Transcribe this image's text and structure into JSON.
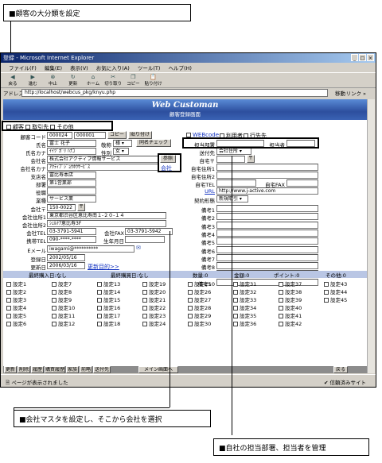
{
  "callouts": {
    "top": "■顧客の大分類を設定",
    "bottom_left": "■会社マスタを設定し、そこから会社を選択",
    "bottom_right": "■自社の担当部署、担当者を管理"
  },
  "window": {
    "title": "登録 - Microsoft Internet Explorer",
    "menu": [
      "ファイル(F)",
      "編集(E)",
      "表示(V)",
      "お気に入り(A)",
      "ツール(T)",
      "ヘルプ(H)"
    ],
    "toolbar": [
      "戻る",
      "進む",
      "中止",
      "更新",
      "ホーム",
      "切り取り",
      "コピー",
      "貼り付け"
    ],
    "address_label": "アドレス(D)",
    "address": "http://localhost/webcus_pkg/knyu.php",
    "go": "移動",
    "links": "リンク »"
  },
  "banner": {
    "title": "Web Customan",
    "subtitle": "顧客登録画面"
  },
  "categories": [
    "顧客",
    "取引先",
    "その他"
  ],
  "form": {
    "customer_code_label": "顧客コード",
    "customer_code": "000024",
    "customer_code2": "000001",
    "copy_btn": "コピー",
    "paste_btn": "貼り付け",
    "name_label": "氏名",
    "name_value": "富士 花子",
    "honorific_label": "敬称",
    "honorific_value": "様",
    "same_name_check": "同名チェック",
    "kana_label": "氏名カナ",
    "kana_value": "ｲｲﾂﾞｶﾞﾘ ﾊﾅｺ",
    "gender_label": "性別",
    "gender_value": "女",
    "company_label": "会社名",
    "company_value": "株式会社アクティブ情報サービス",
    "ref_btn": "参照",
    "company_kana_label": "会社名カナ",
    "company_kana_value": "ｱｸﾃｨﾌﾞｼﾞｮｳﾎｳｻｰﾋﾞｽ",
    "company_link": "会社",
    "branch_label": "支店名",
    "branch_value": "富比寿本店",
    "dept_label": "部署",
    "dept_value": "第1営業部",
    "position_label": "役職",
    "position_value": "",
    "industry_label": "業種",
    "industry_value": "サービス業",
    "zip_label": "会社〒",
    "zip_value": "150-0022",
    "zip_btn": "〒",
    "addr1_label": "会社住所1",
    "addr1_value": "東京都渋谷区恵比寿南１-２０-１４",
    "addr2_label": "会社住所2",
    "addr2_value": "ｼｪﾙﾃｱ恵比寿3F",
    "tel_label": "会社TEL",
    "tel_value": "03-3791-5941",
    "fax_label": "会社FAX",
    "fax_value": "03-3791-5942",
    "mobile_label": "携帯TEL",
    "mobile_value": "090-****-****",
    "birthday_label": "生年月日",
    "birthday_value": "",
    "email_label": "Eメール",
    "email_value": "iwagami@**********",
    "reg_date_label": "登録日",
    "reg_date_value": "2002/05/16",
    "upd_date_label": "更新日",
    "upd_date_value": "2006/03/16",
    "update_purpose_link": "更新目的>>"
  },
  "right_form": {
    "webcode_label": "WEBcode",
    "use_label": "利用者",
    "action_label": "行先先",
    "staff_dept_label": "担当部署",
    "staff_dept_value": "",
    "staff_person_label": "担当者",
    "staff_person_value": "",
    "contact_label": "送付先",
    "contact_value": "会社住所",
    "home_zip_label": "自宅〒",
    "home_zip_btn": "〒",
    "home_addr1_label": "自宅住所1",
    "home_addr2_label": "自宅住所2",
    "home_tel_label": "自宅TEL",
    "home_fax_label": "自宅FAX",
    "url_label": "URL",
    "url_value": "http://www.j-active.com",
    "contract_label": "契約形態",
    "contract_value": "新規取引",
    "notes": [
      "備考1",
      "備考2",
      "備考3",
      "備考4",
      "備考5",
      "備考6",
      "備考7",
      "備考8",
      "備考9",
      "備考10"
    ]
  },
  "summary": {
    "last_purchase": "最終購入日:なし",
    "last_buy": "最終購買日:なし",
    "qty": "数量:0",
    "amount": "金額:0",
    "points": "ポイント:0",
    "other": "その他:0"
  },
  "settings": [
    [
      "設定1",
      "設定7",
      "設定13",
      "設定19",
      "設定25",
      "設定31",
      "設定37",
      "設定43"
    ],
    [
      "設定2",
      "設定8",
      "設定14",
      "設定20",
      "設定26",
      "設定32",
      "設定38",
      "設定44"
    ],
    [
      "設定3",
      "設定9",
      "設定15",
      "設定21",
      "設定27",
      "設定33",
      "設定39",
      "設定45"
    ],
    [
      "設定4",
      "設定10",
      "設定16",
      "設定22",
      "設定28",
      "設定34",
      "設定40",
      ""
    ],
    [
      "設定5",
      "設定11",
      "設定17",
      "設定23",
      "設定29",
      "設定35",
      "設定41",
      ""
    ],
    [
      "設定6",
      "設定12",
      "設定18",
      "設定24",
      "設定30",
      "設定36",
      "設定42",
      ""
    ]
  ],
  "nav": [
    "更新",
    "削除",
    "履歴",
    "購買履歴",
    "家族",
    "前略",
    "送付先",
    "メイン画面へ",
    "戻る"
  ],
  "status": {
    "left": "ページが表示されました",
    "right": "信頼済みサイト"
  }
}
